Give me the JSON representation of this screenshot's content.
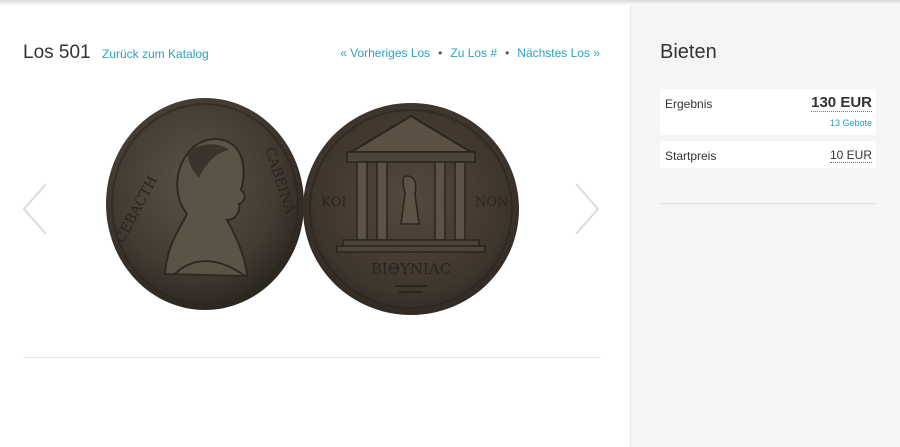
{
  "lot": {
    "title": "Los 501",
    "back_link": "Zurück zum Katalog"
  },
  "nav": {
    "previous": "« Vorheriges Los",
    "goto": "Zu Los #",
    "next": "Nächstes Los »",
    "separator": "•"
  },
  "coin": {
    "obverse_legend_left": "ϹΕΒΑϹΤΗ",
    "obverse_legend_right": "ϹΑΒΕΙΝΑ",
    "reverse_legend_left": "ΚΟΙ",
    "reverse_legend_right": "ΝΟΝ",
    "reverse_legend_bottom": "ΒΙΘΥΝΙΑϹ"
  },
  "bidding": {
    "title": "Bieten",
    "result_label": "Ergebnis",
    "result_value": "130 EUR",
    "bids_count": "13 Gebote",
    "start_label": "Startpreis",
    "start_value": "10 EUR"
  },
  "colors": {
    "accent": "#2aa0c0",
    "text": "#333333",
    "sidebar_bg": "#f5f5f5",
    "coin_metal": "#4a4238"
  }
}
